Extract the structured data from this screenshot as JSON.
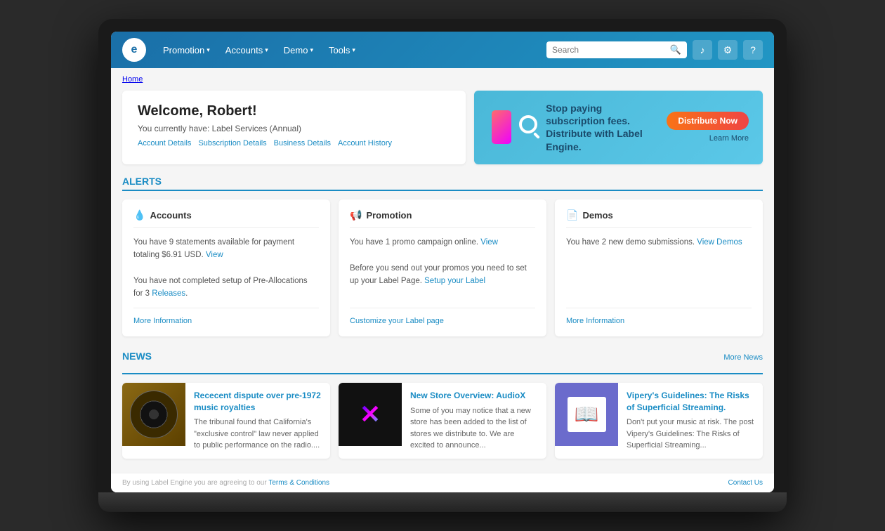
{
  "nav": {
    "logo": "e",
    "items": [
      {
        "label": "Promotion",
        "id": "promotion"
      },
      {
        "label": "Accounts",
        "id": "accounts"
      },
      {
        "label": "Demo",
        "id": "demo"
      },
      {
        "label": "Tools",
        "id": "tools"
      }
    ],
    "search_placeholder": "Search",
    "icons": {
      "music": "♪",
      "settings": "⚙",
      "help": "?"
    }
  },
  "breadcrumb": "Home",
  "welcome": {
    "heading": "Welcome, Robert!",
    "subtitle": "You currently have: Label Services (Annual)",
    "links": [
      {
        "label": "Account Details",
        "id": "account-details"
      },
      {
        "label": "Subscription Details",
        "id": "subscription-details"
      },
      {
        "label": "Business Details",
        "id": "business-details"
      },
      {
        "label": "Account History",
        "id": "account-history"
      }
    ]
  },
  "banner": {
    "headline": "Stop paying subscription fees.\nDistribute with Label Engine.",
    "cta_button": "Distribute Now",
    "learn_more": "Learn More"
  },
  "alerts": {
    "section_title": "ALERTS",
    "cards": [
      {
        "id": "accounts-alert",
        "icon": "💧",
        "title": "Accounts",
        "body1": "You have 9 statements available for payment totaling $6.91 USD.",
        "body1_link": "View",
        "body2": "You have not completed setup of Pre-Allocations for 3 Releases.",
        "body2_link": "Releases",
        "footer_link": "More Information"
      },
      {
        "id": "promotion-alert",
        "icon": "📢",
        "title": "Promotion",
        "body1": "You have 1 promo campaign online.",
        "body1_link": "View",
        "body2": "Before you send out your promos you need to set up your Label Page.",
        "body2_link": "Setup your Label",
        "footer_link": "Customize your Label page"
      },
      {
        "id": "demos-alert",
        "icon": "📄",
        "title": "Demos",
        "body1": "You have 2 new demo submissions.",
        "body1_link": "View Demos",
        "footer_link": "More Information"
      }
    ]
  },
  "news": {
    "section_title": "NEWS",
    "more_link": "More News",
    "articles": [
      {
        "id": "article-1",
        "title": "Rececent dispute over pre-1972 music royalties",
        "excerpt": "The tribunal found that California's \"exclusive control\" law never applied to public performance on the radio....",
        "thumb_type": "vinyl"
      },
      {
        "id": "article-2",
        "title": "New Store Overview: AudioX",
        "excerpt": "Some of you may notice that a new store has been added to the list of stores we distribute to. We are excited to announce...",
        "thumb_type": "audiox"
      },
      {
        "id": "article-3",
        "title": "Vipery's Guidelines: The Risks of Superficial Streaming.",
        "excerpt": "Don't put your music at risk. The post Vipery's Guidelines: The Risks of Superficial Streaming...",
        "thumb_type": "vipery"
      }
    ]
  },
  "footer": {
    "terms_text": "By using Label Engine you are agreeing to our",
    "terms_link": "Terms & Conditions",
    "contact": "Contact Us"
  }
}
